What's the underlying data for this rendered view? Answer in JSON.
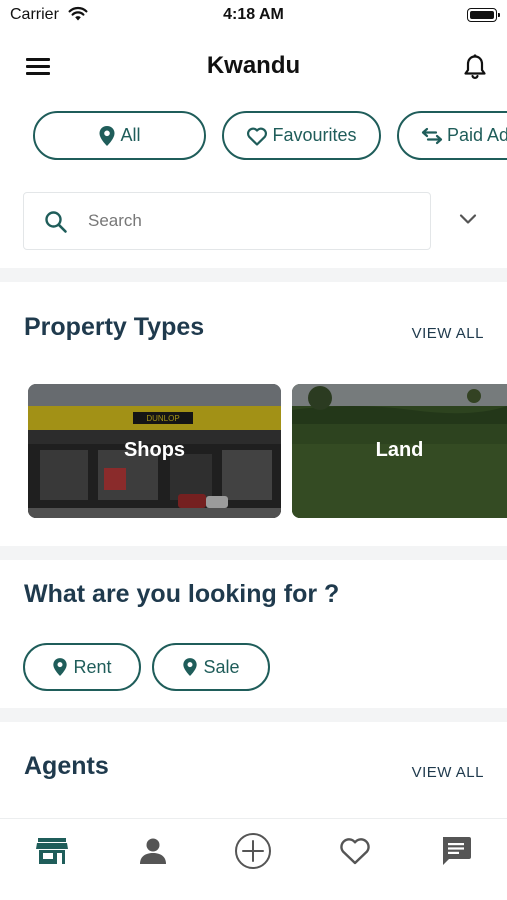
{
  "status_bar": {
    "carrier": "Carrier",
    "time": "4:18 AM"
  },
  "header": {
    "title": "Kwandu",
    "menu_icon": "hamburger-icon",
    "notification_icon": "bell-icon"
  },
  "filters": [
    {
      "label": "All",
      "icon": "location-pin-icon"
    },
    {
      "label": "Favourites",
      "icon": "heart-outline-icon"
    },
    {
      "label": "Paid Ad",
      "icon": "swap-arrows-icon"
    }
  ],
  "search": {
    "placeholder": "Search",
    "value": ""
  },
  "property_types": {
    "title": "Property Types",
    "view_all": "VIEW ALL",
    "items": [
      {
        "label": "Shops",
        "sign_text": "DUNLOP"
      },
      {
        "label": "Land"
      }
    ]
  },
  "looking_for": {
    "title": "What are you looking for ?",
    "options": [
      {
        "label": "Rent"
      },
      {
        "label": "Sale"
      }
    ]
  },
  "agents": {
    "title": "Agents",
    "view_all": "VIEW ALL"
  },
  "tab_bar": {
    "tabs": [
      {
        "name": "store-icon",
        "active": true
      },
      {
        "name": "person-icon",
        "active": false
      },
      {
        "name": "add-circle-icon",
        "active": false
      },
      {
        "name": "heart-icon",
        "active": false
      },
      {
        "name": "chat-icon",
        "active": false
      }
    ]
  },
  "colors": {
    "accent": "#1f5d5a",
    "title": "#1f3a4d",
    "divider": "#f3f4f5",
    "inactive_icon": "#555555"
  }
}
